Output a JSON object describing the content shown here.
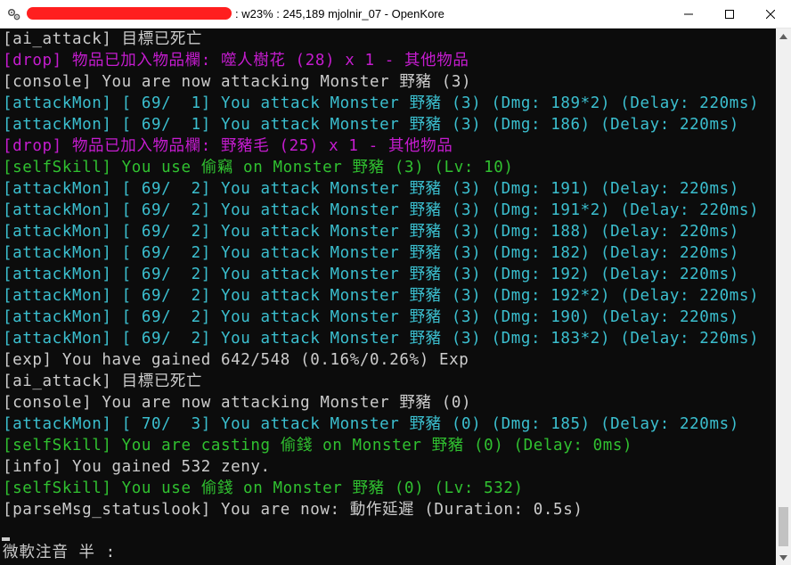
{
  "window": {
    "title": ": w23% : 245,189 mjolnir_07 - OpenKore",
    "icon": "gears-icon",
    "controls": {
      "minimize": "minimize-icon",
      "maximize": "maximize-icon",
      "close": "close-icon"
    }
  },
  "colors": {
    "white": "#cccccc",
    "magenta": "#c51ccf",
    "cyan": "#3bbfcf",
    "green": "#30c030",
    "background": "#0c0c0c"
  },
  "log": [
    {
      "text": "[ai_attack] 目標已死亡",
      "color": "white"
    },
    {
      "text": "[drop] 物品已加入物品欄: 噬人樹花 (28) x 1 - 其他物品",
      "color": "magenta"
    },
    {
      "text": "[console] You are now attacking Monster 野豬 (3)",
      "color": "white"
    },
    {
      "text": "[attackMon] [ 69/  1] You attack Monster 野豬 (3) (Dmg: 189*2) (Delay: 220ms)",
      "color": "cyan"
    },
    {
      "text": "[attackMon] [ 69/  1] You attack Monster 野豬 (3) (Dmg: 186) (Delay: 220ms)",
      "color": "cyan"
    },
    {
      "text": "[drop] 物品已加入物品欄: 野豬毛 (25) x 1 - 其他物品",
      "color": "magenta"
    },
    {
      "text": "[selfSkill] You use 偷竊 on Monster 野豬 (3) (Lv: 10)",
      "color": "green"
    },
    {
      "text": "[attackMon] [ 69/  2] You attack Monster 野豬 (3) (Dmg: 191) (Delay: 220ms)",
      "color": "cyan"
    },
    {
      "text": "[attackMon] [ 69/  2] You attack Monster 野豬 (3) (Dmg: 191*2) (Delay: 220ms)",
      "color": "cyan"
    },
    {
      "text": "[attackMon] [ 69/  2] You attack Monster 野豬 (3) (Dmg: 188) (Delay: 220ms)",
      "color": "cyan"
    },
    {
      "text": "[attackMon] [ 69/  2] You attack Monster 野豬 (3) (Dmg: 182) (Delay: 220ms)",
      "color": "cyan"
    },
    {
      "text": "[attackMon] [ 69/  2] You attack Monster 野豬 (3) (Dmg: 192) (Delay: 220ms)",
      "color": "cyan"
    },
    {
      "text": "[attackMon] [ 69/  2] You attack Monster 野豬 (3) (Dmg: 192*2) (Delay: 220ms)",
      "color": "cyan"
    },
    {
      "text": "[attackMon] [ 69/  2] You attack Monster 野豬 (3) (Dmg: 190) (Delay: 220ms)",
      "color": "cyan"
    },
    {
      "text": "[attackMon] [ 69/  2] You attack Monster 野豬 (3) (Dmg: 183*2) (Delay: 220ms)",
      "color": "cyan"
    },
    {
      "text": "[exp] You have gained 642/548 (0.16%/0.26%) Exp",
      "color": "white"
    },
    {
      "text": "[ai_attack] 目標已死亡",
      "color": "white"
    },
    {
      "text": "[console] You are now attacking Monster 野豬 (0)",
      "color": "white"
    },
    {
      "text": "[attackMon] [ 70/  3] You attack Monster 野豬 (0) (Dmg: 185) (Delay: 220ms)",
      "color": "cyan"
    },
    {
      "text": "[selfSkill] You are casting 偷錢 on Monster 野豬 (0) (Delay: 0ms)",
      "color": "green"
    },
    {
      "text": "[info] You gained 532 zeny.",
      "color": "white"
    },
    {
      "text": "[selfSkill] You use 偷錢 on Monster 野豬 (0) (Lv: 532)",
      "color": "green"
    },
    {
      "text": "[parseMsg_statuslook] You are now: 動作延遲 (Duration: 0.5s)",
      "color": "white"
    }
  ],
  "ime": {
    "text": "微軟注音 半 :"
  }
}
